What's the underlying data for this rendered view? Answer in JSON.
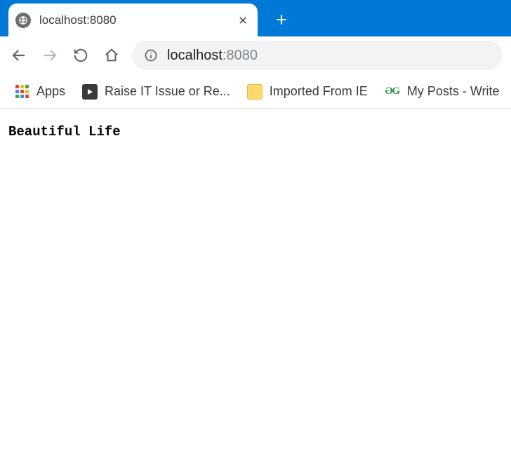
{
  "tab": {
    "title": "localhost:8080"
  },
  "address": {
    "host": "localhost",
    "path": ":8080"
  },
  "bookmarks": {
    "apps": "Apps",
    "raise": "Raise IT Issue or Re...",
    "imported": "Imported From IE",
    "myposts": "My Posts - Write"
  },
  "page": {
    "text": "Beautiful Life"
  }
}
